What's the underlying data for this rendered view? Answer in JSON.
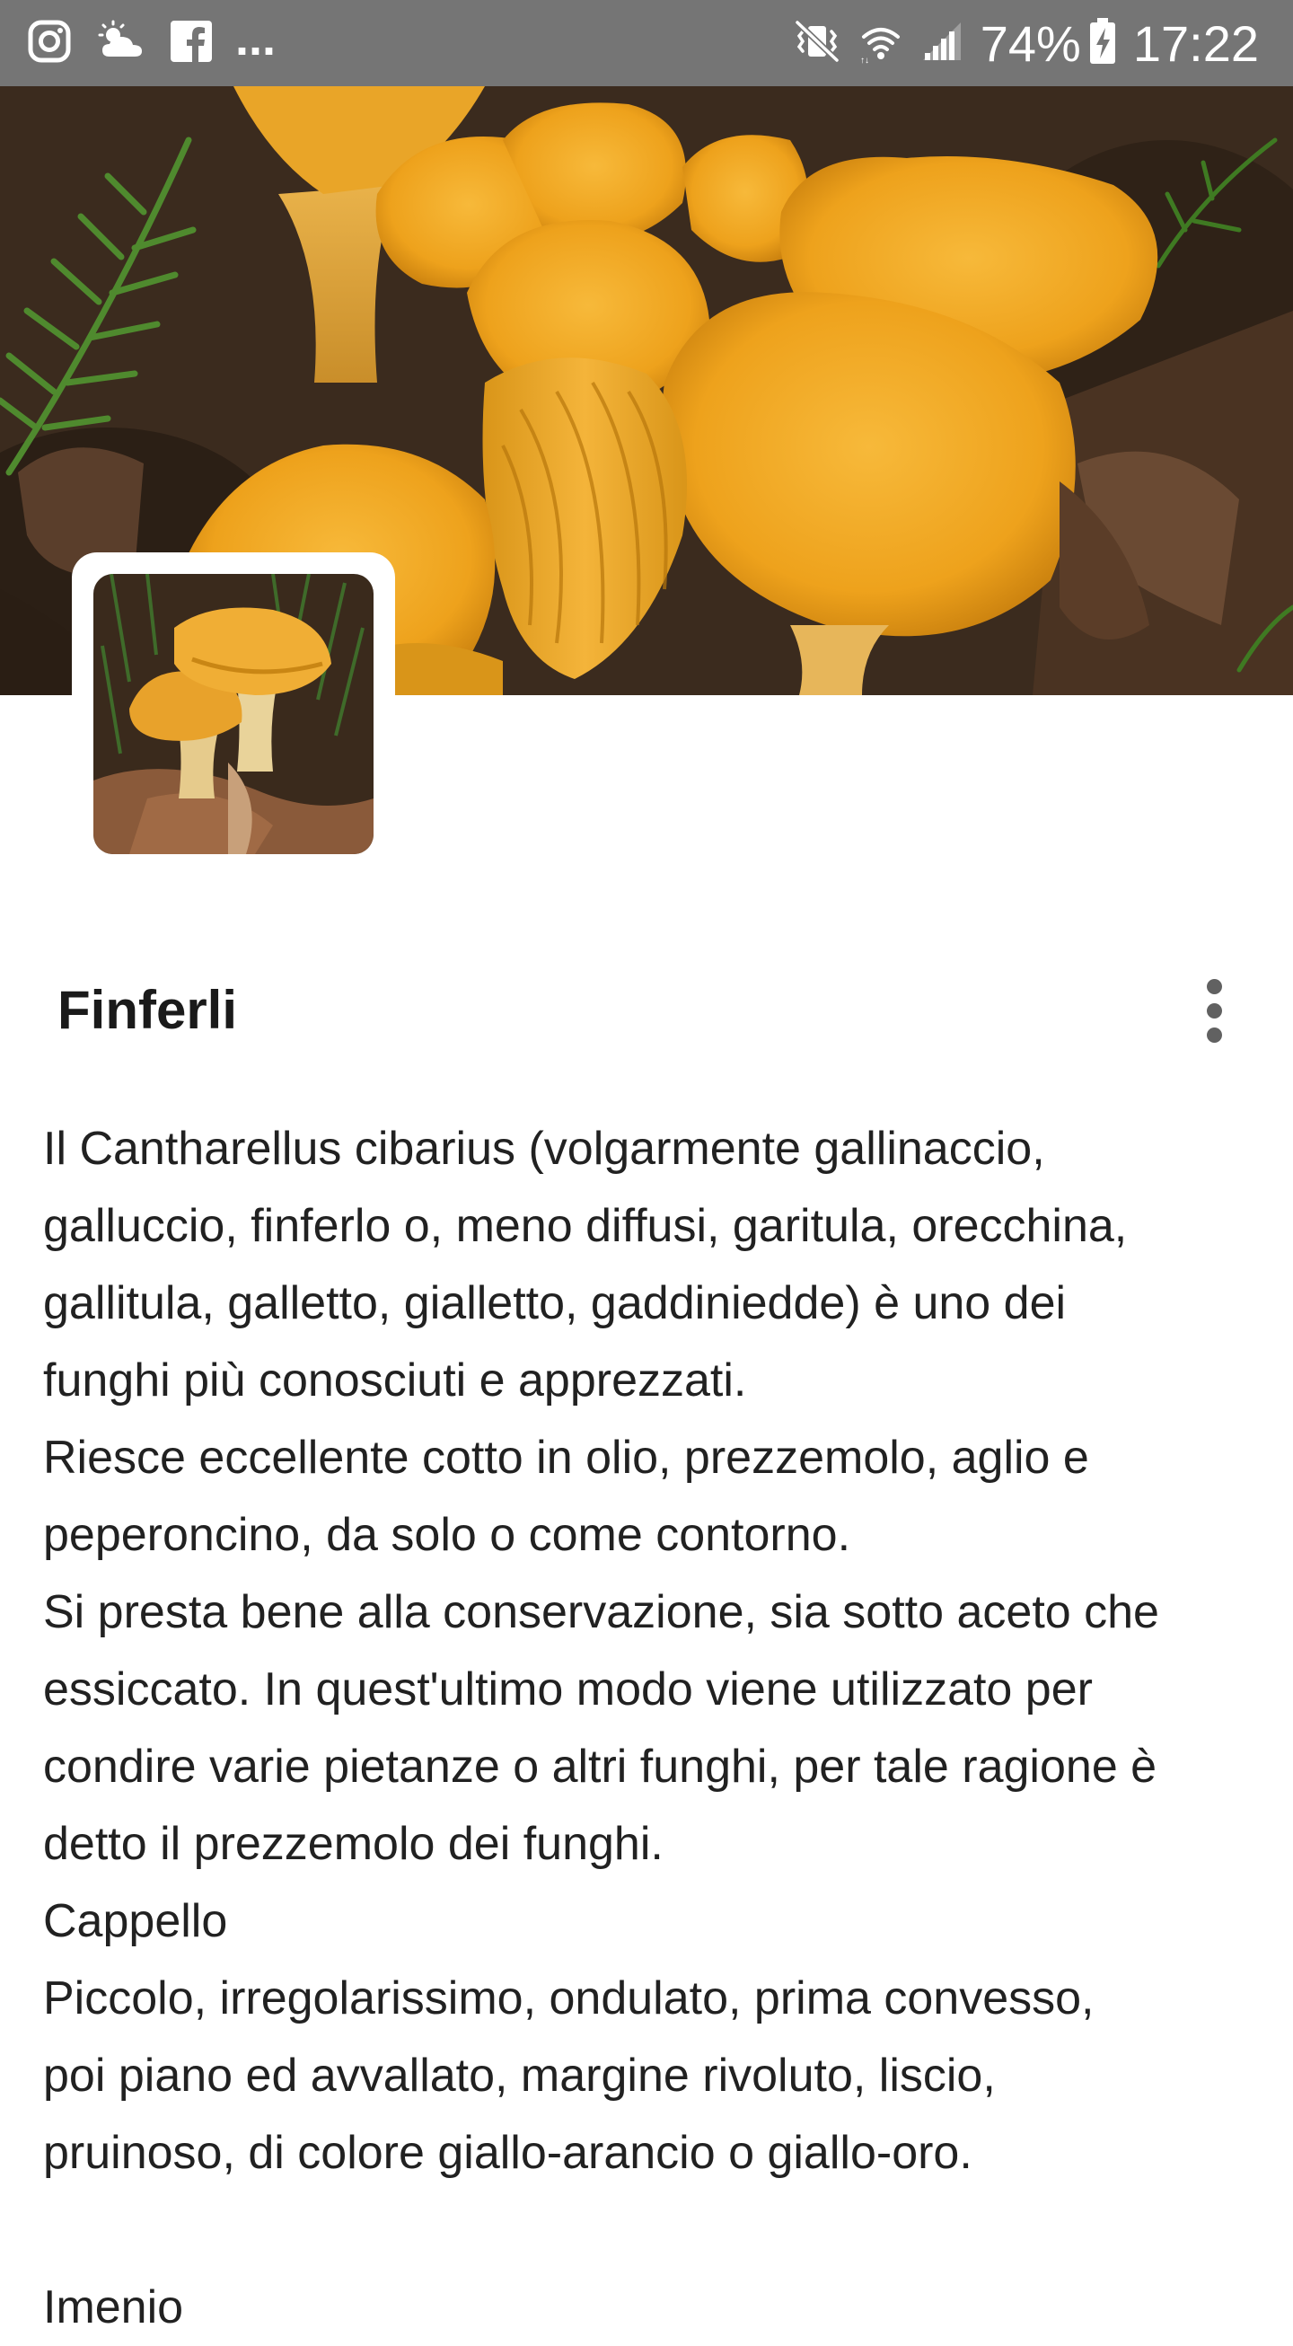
{
  "status_bar": {
    "left_icons": [
      "instagram-icon",
      "weather-cloudy-sun-icon",
      "facebook-icon"
    ],
    "more_notifications": "...",
    "right_icons": [
      "vibrate-mute-icon",
      "wifi-icon",
      "signal-icon",
      "battery-charging-icon"
    ],
    "battery": "74%",
    "time": "17:22",
    "background_color": "#757575"
  },
  "header": {
    "image_subject": "chanterelle mushrooms",
    "accent_color": "#F2A722"
  },
  "thumbnail": {
    "image_subject": "chanterelle mushrooms"
  },
  "item": {
    "title": "Finferli",
    "more_button_icon": "more-vert-icon"
  },
  "description": {
    "lines": [
      "Il Cantharellus cibarius (volgarmente gallinaccio,",
      "galluccio, finferlo o, meno diffusi, garitula, orecchina,",
      "gallitula, galletto, gialletto, gaddiniedde) è uno dei",
      "funghi più conosciuti e apprezzati.",
      "Riesce eccellente cotto in olio, prezzemolo, aglio e",
      "peperoncino, da solo o come contorno.",
      "Si presta bene alla conservazione, sia sotto aceto che",
      "essiccato. In quest'ultimo modo viene utilizzato per",
      "condire varie pietanze o altri funghi, per tale ragione è",
      "detto il prezzemolo dei funghi.",
      "Cappello",
      "Piccolo, irregolarissimo, ondulato, prima convesso,",
      "poi piano ed avvallato, margine rivoluto, liscio,",
      "pruinoso, di colore giallo-arancio o giallo-oro.",
      "",
      "Imenio"
    ]
  }
}
